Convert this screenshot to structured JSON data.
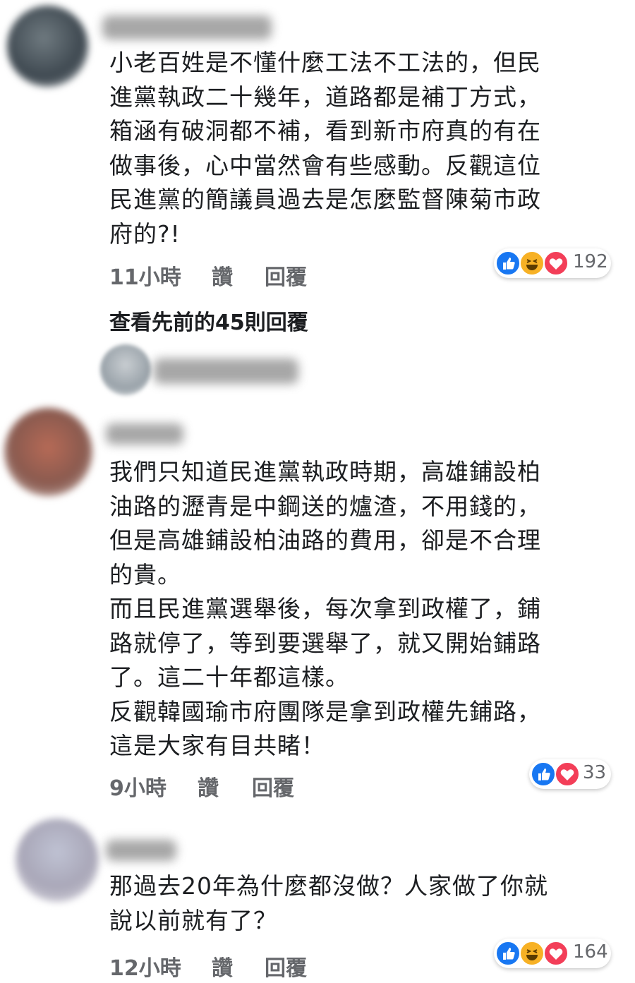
{
  "comments": [
    {
      "text": "小老百姓是不懂什麼工法不工法的，但民\n進黨執政二十幾年，道路都是補丁方式，\n箱涵有破洞都不補，看到新市府真的有在\n做事後，心中當然會有些感動。反觀這位\n民進黨的簡議員過去是怎麼監督陳菊市政\n府的?!",
      "time": "11小時",
      "like_label": "讚",
      "reply_label": "回覆",
      "reactions": [
        "like",
        "haha",
        "love"
      ],
      "reaction_count": "192"
    },
    {
      "text": "我們只知道民進黨執政時期，高雄鋪設柏\n油路的瀝青是中鋼送的爐渣，不用錢的，\n但是高雄鋪設柏油路的費用，卻是不合理\n的貴。\n而且民進黨選舉後，每次拿到政權了，鋪\n路就停了，等到要選舉了，就又開始鋪路\n了。這二十年都這樣。\n反觀韓國瑜市府團隊是拿到政權先鋪路，\n這是大家有目共睹！",
      "time": "9小時",
      "like_label": "讚",
      "reply_label": "回覆",
      "reactions": [
        "like",
        "love"
      ],
      "reaction_count": "33"
    },
    {
      "text": "那過去20年為什麼都沒做？人家做了你就\n說以前就有了？",
      "time": "12小時",
      "like_label": "讚",
      "reply_label": "回覆",
      "reactions": [
        "like",
        "haha",
        "love"
      ],
      "reaction_count": "164"
    }
  ],
  "view_previous_replies": "查看先前的45則回覆",
  "colors": {
    "bubble": "#f0f2f5",
    "like": "#1877f2",
    "love": "#f33e58",
    "haha": "#f7b125",
    "meta": "#65676b"
  }
}
